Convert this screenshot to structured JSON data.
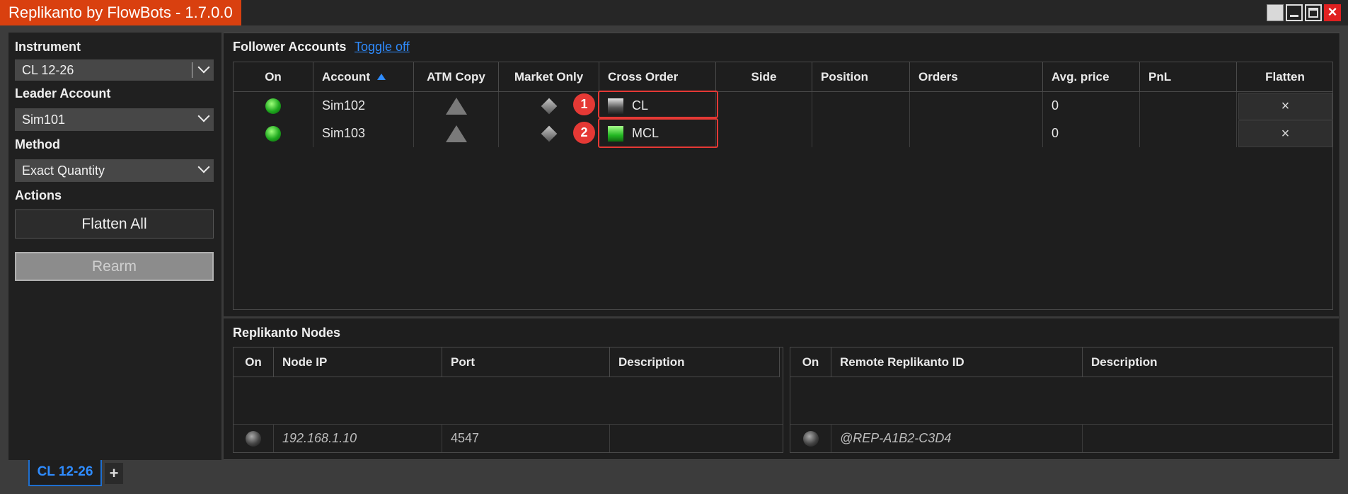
{
  "window": {
    "title": "Replikanto by FlowBots - 1.7.0.0"
  },
  "left": {
    "instrument_label": "Instrument",
    "instrument_value": "CL 12-26",
    "leader_label": "Leader Account",
    "leader_value": "Sim101",
    "method_label": "Method",
    "method_value": "Exact Quantity",
    "actions_label": "Actions",
    "flatten_all": "Flatten All",
    "rearm": "Rearm"
  },
  "followers": {
    "title": "Follower Accounts",
    "toggle": "Toggle off",
    "columns": [
      "On",
      "Account",
      "ATM Copy",
      "Market Only",
      "Cross Order",
      "Side",
      "Position",
      "Orders",
      "Avg. price",
      "PnL",
      "Flatten"
    ],
    "rows": [
      {
        "account": "Sim102",
        "cross_order": "CL",
        "cross_color": "gray",
        "side": "",
        "position": "",
        "orders": "",
        "avg_price": "0",
        "pnl": "",
        "flatten": "×",
        "badge": "1"
      },
      {
        "account": "Sim103",
        "cross_order": "MCL",
        "cross_color": "green",
        "side": "",
        "position": "",
        "orders": "",
        "avg_price": "0",
        "pnl": "",
        "flatten": "×",
        "badge": "2"
      }
    ]
  },
  "nodes": {
    "title": "Replikanto Nodes",
    "left_columns": [
      "On",
      "Node IP",
      "Port",
      "Description"
    ],
    "left_row": {
      "ip": "192.168.1.10",
      "port": "4547",
      "description": ""
    },
    "right_columns": [
      "On",
      "Remote Replikanto ID",
      "Description"
    ],
    "right_row": {
      "id": "@REP-A1B2-C3D4",
      "description": ""
    }
  },
  "tabs": {
    "active": "CL 12-26",
    "add": "+"
  },
  "colors": {
    "title_accent": "#d9400f",
    "link": "#2f8cff",
    "highlight": "#e53935"
  }
}
